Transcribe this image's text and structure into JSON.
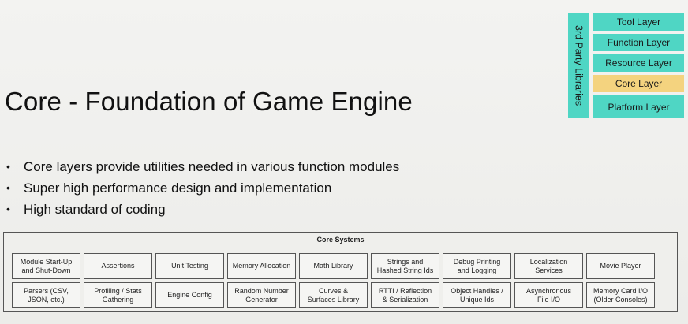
{
  "title": "Core - Foundation of Game Engine",
  "bullets": [
    "Core layers provide utilities needed in various function modules",
    "Super high performance design and implementation",
    "High standard of coding"
  ],
  "layer_stack": {
    "side_label": "3rd Party Libraries",
    "layers": [
      {
        "label": "Tool Layer",
        "color": "#4fd6c4"
      },
      {
        "label": "Function Layer",
        "color": "#4fd6c4"
      },
      {
        "label": "Resource Layer",
        "color": "#4fd6c4"
      },
      {
        "label": "Core Layer",
        "color": "#f4d37f"
      },
      {
        "label": "Platform Layer",
        "color": "#4fd6c4"
      }
    ]
  },
  "core_systems": {
    "title": "Core Systems",
    "row1": [
      "Module Start-Up\nand Shut-Down",
      "Assertions",
      "Unit Testing",
      "Memory Allocation",
      "Math Library",
      "Strings and\nHashed String Ids",
      "Debug Printing\nand Logging",
      "Localization\nServices",
      "Movie Player"
    ],
    "row2": [
      "Parsers (CSV,\nJSON, etc.)",
      "Profiling / Stats\nGathering",
      "Engine Config",
      "Random Number\nGenerator",
      "Curves &\nSurfaces Library",
      "RTTI / Reflection\n& Serialization",
      "Object Handles /\nUnique Ids",
      "Asynchronous\nFile I/O",
      "Memory Card I/O\n(Older Consoles)"
    ]
  }
}
